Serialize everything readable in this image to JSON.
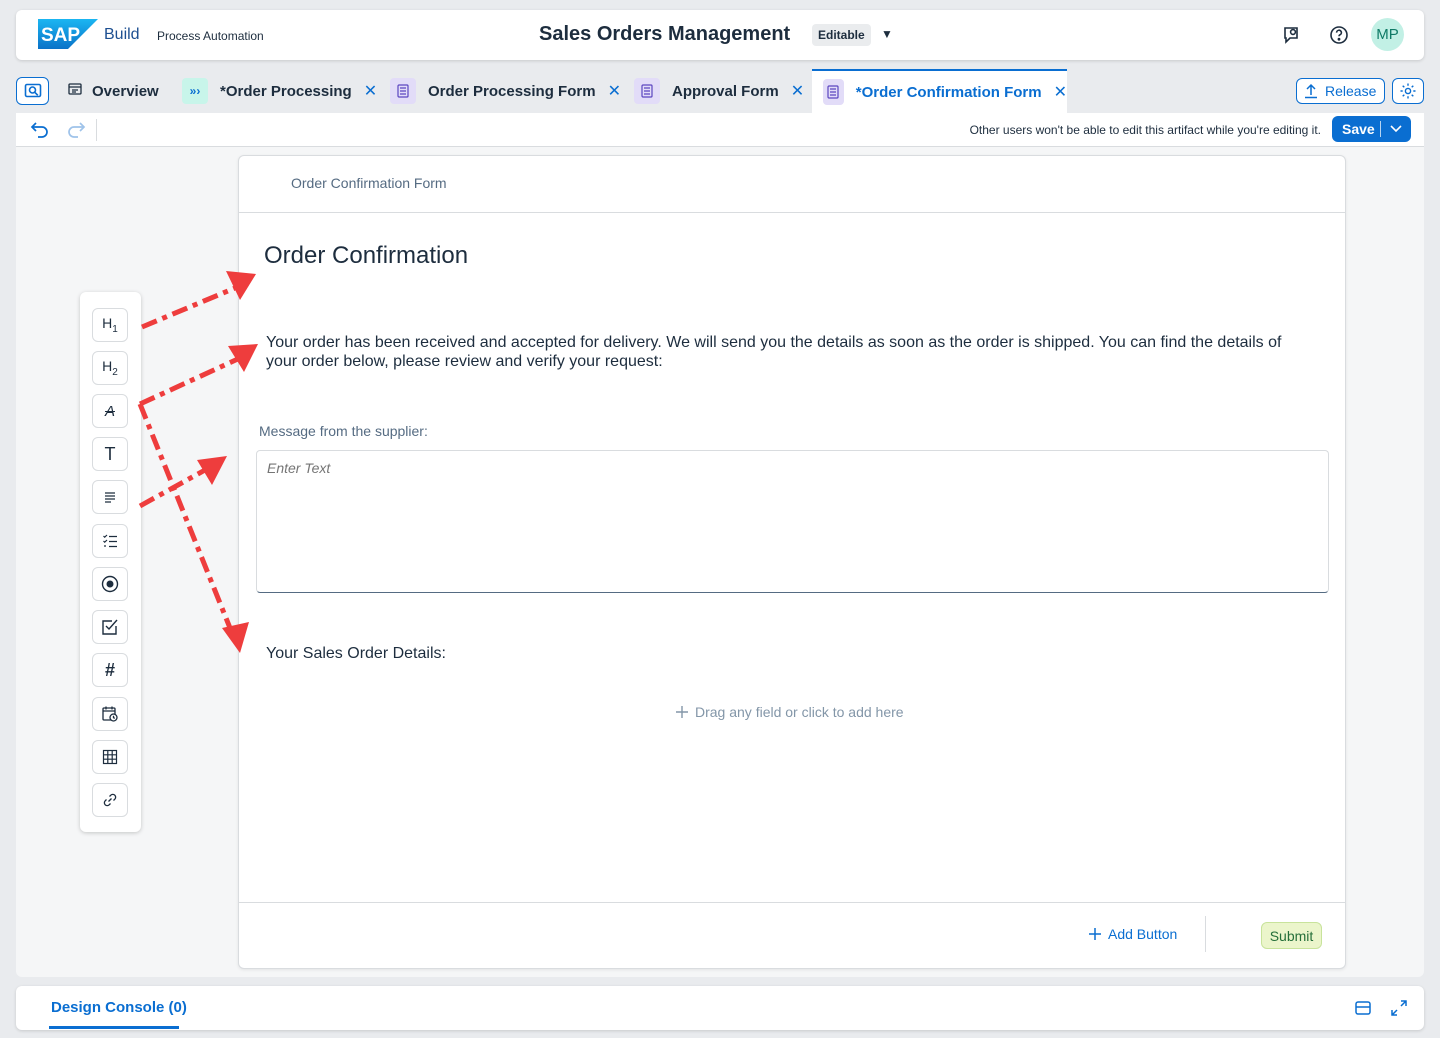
{
  "shell": {
    "logo_text": "SAP",
    "product": "Build",
    "subproduct": "Process Automation",
    "project_title": "Sales Orders Management",
    "mode_badge": "Editable",
    "user_initials": "MP",
    "icons": [
      "feedback-icon",
      "help-icon"
    ]
  },
  "tabs": [
    {
      "label": "Overview",
      "icon": "overview-icon",
      "closable": false,
      "active": false
    },
    {
      "label": "*Order Processing",
      "icon": "process-icon",
      "closable": true,
      "active": false
    },
    {
      "label": "Order Processing Form",
      "icon": "form-icon",
      "closable": true,
      "active": false
    },
    {
      "label": "Approval Form",
      "icon": "form-icon",
      "closable": true,
      "active": false
    },
    {
      "label": "*Order Confirmation Form",
      "icon": "form-icon",
      "closable": true,
      "active": true
    }
  ],
  "actions": {
    "release_label": "Release"
  },
  "toolbar": {
    "notice": "Other users won't be able to edit this artifact while you're editing it.",
    "save_label": "Save"
  },
  "palette": [
    {
      "name": "heading1",
      "label": "H1"
    },
    {
      "name": "heading2",
      "label": "H2"
    },
    {
      "name": "rich-text",
      "label": "A"
    },
    {
      "name": "text",
      "label": "T"
    },
    {
      "name": "paragraph",
      "label": ""
    },
    {
      "name": "checklist",
      "label": ""
    },
    {
      "name": "radio",
      "label": ""
    },
    {
      "name": "checkbox",
      "label": ""
    },
    {
      "name": "number",
      "label": "#"
    },
    {
      "name": "date",
      "label": ""
    },
    {
      "name": "table",
      "label": ""
    },
    {
      "name": "link",
      "label": ""
    }
  ],
  "form": {
    "name": "Order Confirmation Form",
    "heading": "Order Confirmation",
    "paragraph": "Your order has been received and accepted for delivery. We will send you the details as soon as the order is shipped. You can find the details of your order below, please review and verify your request:",
    "message_label": "Message from the supplier:",
    "message_placeholder": "Enter Text",
    "details_label": "Your Sales Order Details:",
    "drop_hint": "Drag any field or click to add here",
    "add_button_label": "Add Button",
    "submit_label": "Submit"
  },
  "console": {
    "tab_label": "Design Console (0)"
  },
  "colors": {
    "accent": "#0a6ed1",
    "arrow": "#ee3d3d",
    "submit_bg": "#ebf5cb"
  }
}
